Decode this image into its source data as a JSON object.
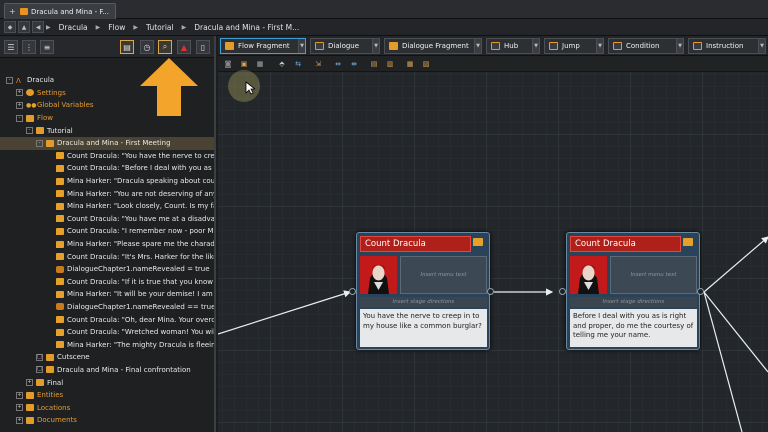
{
  "window": {
    "tab_title": "Dracula and Mina - F...",
    "tab_plus": "+"
  },
  "breadcrumb": {
    "items": [
      "Dracula",
      "Flow",
      "Tutorial",
      "Dracula and Mina - First M..."
    ]
  },
  "left_toolbar": {
    "buttons": [
      "list-icon",
      "tree-icon",
      "flag-icon",
      "clock-icon",
      "search-icon",
      "warning-icon",
      "document-icon"
    ]
  },
  "tree": {
    "rows": [
      {
        "label": "Dracula",
        "indent": 0,
        "icon": "dracula",
        "exp": "-"
      },
      {
        "label": "Settings",
        "indent": 1,
        "icon": "gear",
        "exp": "+",
        "orange": true
      },
      {
        "label": "Global Variables",
        "indent": 1,
        "icon": "dots",
        "exp": "+",
        "orange": true
      },
      {
        "label": "Flow",
        "indent": 1,
        "icon": "folder",
        "exp": "-",
        "orange": true
      },
      {
        "label": "Tutorial",
        "indent": 2,
        "icon": "folder",
        "exp": "-"
      },
      {
        "label": "Dracula and Mina - First Meeting",
        "indent": 3,
        "icon": "folder",
        "exp": "-",
        "selected": true
      },
      {
        "label": "Count Dracula: \"You have the nerve to creep in t",
        "indent": 4,
        "icon": "bubble"
      },
      {
        "label": "Count Dracula: \"Before I deal with you as is right",
        "indent": 4,
        "icon": "bubble"
      },
      {
        "label": "Mina Harker: \"Dracula speaking about courtesy?",
        "indent": 4,
        "icon": "bubble"
      },
      {
        "label": "Mina Harker: \"You are not deserving of any cour",
        "indent": 4,
        "icon": "bubble"
      },
      {
        "label": "Mina Harker: \"Look closely, Count. Is my face no",
        "indent": 4,
        "icon": "bubble"
      },
      {
        "label": "Count Dracula: \"You have me at a disadvantage,",
        "indent": 4,
        "icon": "bubble"
      },
      {
        "label": "Count Dracula: \"I remember now - poor Mr. Har",
        "indent": 4,
        "icon": "bubble"
      },
      {
        "label": "Mina Harker: \"Please spare me the charade. I kn",
        "indent": 4,
        "icon": "bubble"
      },
      {
        "label": "Count Dracula: \"It's Mrs. Harker for the likes of y",
        "indent": 4,
        "icon": "bubble"
      },
      {
        "label": "DialogueChapter1.nameRevealed = true",
        "indent": 4,
        "icon": "cond"
      },
      {
        "label": "Count Dracula: \"If it is true that you know and u",
        "indent": 4,
        "icon": "bubble"
      },
      {
        "label": "Mina Harker: \"It will be your demise! I am not as",
        "indent": 4,
        "icon": "bubble"
      },
      {
        "label": "DialogueChapter1.nameRevealed == true",
        "indent": 4,
        "icon": "cond"
      },
      {
        "label": "Count Dracula: \"Oh, dear Mina. Your overconfid",
        "indent": 4,
        "icon": "bubble"
      },
      {
        "label": "Count Dracula: \"Wretched woman! You will no l",
        "indent": 4,
        "icon": "bubble"
      },
      {
        "label": "Mina Harker: \"The mighty Dracula is fleeing fror",
        "indent": 4,
        "icon": "bubble"
      },
      {
        "label": "Cutscene",
        "indent": 3,
        "icon": "folder",
        "exp": "□"
      },
      {
        "label": "Dracula and Mina - Final confrontation",
        "indent": 3,
        "icon": "folder",
        "exp": "□"
      },
      {
        "label": "Final",
        "indent": 2,
        "icon": "folder",
        "exp": "+"
      },
      {
        "label": "Entities",
        "indent": 1,
        "icon": "folder",
        "exp": "+",
        "orange": true
      },
      {
        "label": "Locations",
        "indent": 1,
        "icon": "folder",
        "exp": "+",
        "orange": true
      },
      {
        "label": "Documents",
        "indent": 1,
        "icon": "folder",
        "exp": "+",
        "orange": true
      }
    ]
  },
  "flow_tabs": [
    "Flow Fragment",
    "Dialogue",
    "Dialogue Fragment",
    "Hub",
    "Jump",
    "Condition",
    "Instruction"
  ],
  "nodes": [
    {
      "speaker": "Count Dracula",
      "menu_placeholder": "Insert menu text",
      "stage_placeholder": "Insert stage directions",
      "text": "You have the nerve to creep in to my house like a common burglar?"
    },
    {
      "speaker": "Count Dracula",
      "menu_placeholder": "Insert menu text",
      "stage_placeholder": "Insert stage directions",
      "text": "Before I deal with you as is right and proper, do me the courtesy of telling me your name."
    }
  ],
  "colors": {
    "accent": "#e89c2e",
    "node_header": "#b0201a",
    "node_body": "#28435a"
  }
}
